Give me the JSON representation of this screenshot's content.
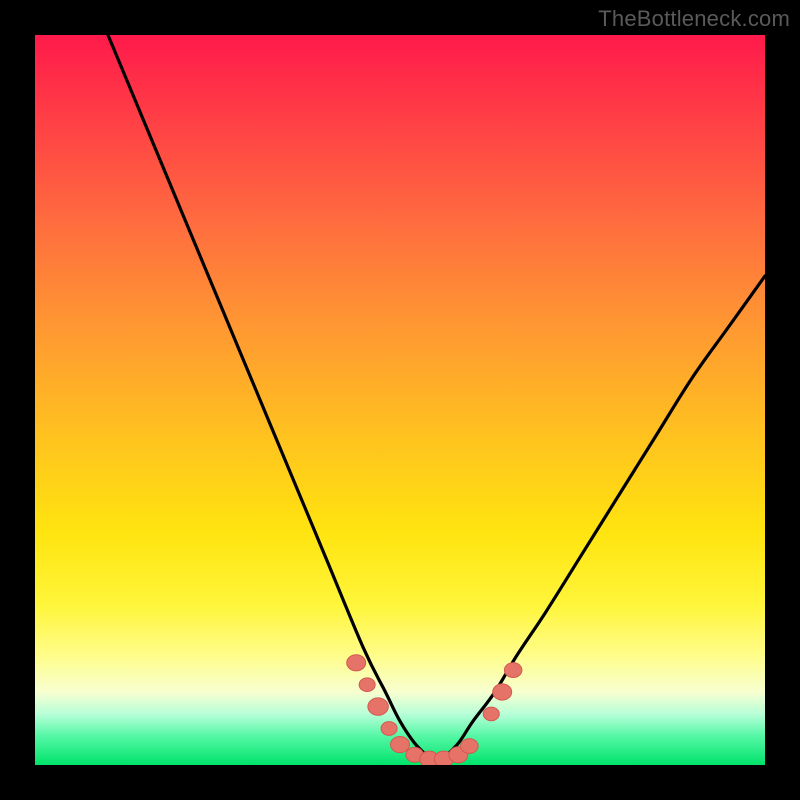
{
  "watermark": "TheBottleneck.com",
  "colors": {
    "frame": "#000000",
    "curve": "#000000",
    "marker_fill": "#e57368",
    "marker_stroke": "#d4584f",
    "gradient_top": "#ff1a4b",
    "gradient_bottom": "#00e36a"
  },
  "chart_data": {
    "type": "line",
    "title": "",
    "xlabel": "",
    "ylabel": "",
    "xlim": [
      0,
      100
    ],
    "ylim": [
      0,
      100
    ],
    "grid": false,
    "legend": false,
    "background_meaning": "vertical gradient maps bottleneck severity: red≈100%, green≈0%",
    "series": [
      {
        "name": "left-curve",
        "x": [
          10,
          15,
          20,
          25,
          30,
          35,
          40,
          45,
          48,
          50,
          52,
          54
        ],
        "y": [
          100,
          88,
          76,
          64,
          52,
          40,
          28,
          16,
          10,
          6,
          3,
          1
        ]
      },
      {
        "name": "right-curve",
        "x": [
          56,
          58,
          60,
          63,
          66,
          70,
          75,
          80,
          85,
          90,
          95,
          100
        ],
        "y": [
          1,
          3,
          6,
          10,
          15,
          21,
          29,
          37,
          45,
          53,
          60,
          67
        ]
      }
    ],
    "markers": [
      {
        "x": 44.0,
        "y": 14.0,
        "r": 1.3
      },
      {
        "x": 45.5,
        "y": 11.0,
        "r": 1.1
      },
      {
        "x": 47.0,
        "y": 8.0,
        "r": 1.4
      },
      {
        "x": 48.5,
        "y": 5.0,
        "r": 1.1
      },
      {
        "x": 50.0,
        "y": 2.8,
        "r": 1.3
      },
      {
        "x": 52.0,
        "y": 1.4,
        "r": 1.2
      },
      {
        "x": 54.0,
        "y": 0.8,
        "r": 1.3
      },
      {
        "x": 56.0,
        "y": 0.8,
        "r": 1.3
      },
      {
        "x": 58.0,
        "y": 1.4,
        "r": 1.3
      },
      {
        "x": 59.5,
        "y": 2.6,
        "r": 1.2
      },
      {
        "x": 62.5,
        "y": 7.0,
        "r": 1.1
      },
      {
        "x": 64.0,
        "y": 10.0,
        "r": 1.3
      },
      {
        "x": 65.5,
        "y": 13.0,
        "r": 1.2
      }
    ]
  }
}
